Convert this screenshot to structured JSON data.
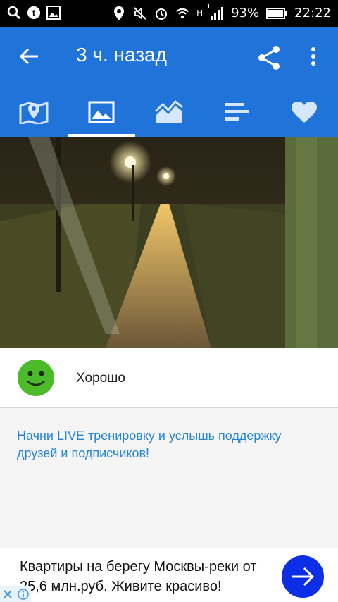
{
  "status_bar": {
    "battery": "93%",
    "time": "22:22",
    "network": "H",
    "sim": "1",
    "icons": [
      "search-icon",
      "tumblr-icon",
      "image-icon",
      "location-icon",
      "mute-icon",
      "alarm-icon",
      "wifi-icon",
      "signal-icon",
      "battery-icon"
    ]
  },
  "appbar": {
    "title": "3 ч. назад",
    "icons": [
      "back-arrow-icon",
      "share-icon",
      "more-vert-icon"
    ]
  },
  "tabs": [
    {
      "icon": "map-icon"
    },
    {
      "icon": "photo-icon",
      "selected": true
    },
    {
      "icon": "chart-icon"
    },
    {
      "icon": "bars-icon"
    },
    {
      "icon": "heart-icon"
    }
  ],
  "photo": {
    "icon": "park-photo"
  },
  "rating": {
    "label": "Хорошо",
    "icon": "smiley-good-icon",
    "color": "#4cbb2a"
  },
  "promo": {
    "text": "Начни LIVE тренировку и услышь поддержку друзей и подписчиков!"
  },
  "ad": {
    "text": "Квартиры на берегу Москвы-реки от 25,6 млн.руб. Живите красиво!",
    "badges": [
      "close-icon",
      "info-icon"
    ],
    "button_icon": "arrow-right-icon"
  },
  "colors": {
    "primary": "#1f73d9",
    "link": "#2585d8",
    "accent_button": "#0c2ee6"
  }
}
